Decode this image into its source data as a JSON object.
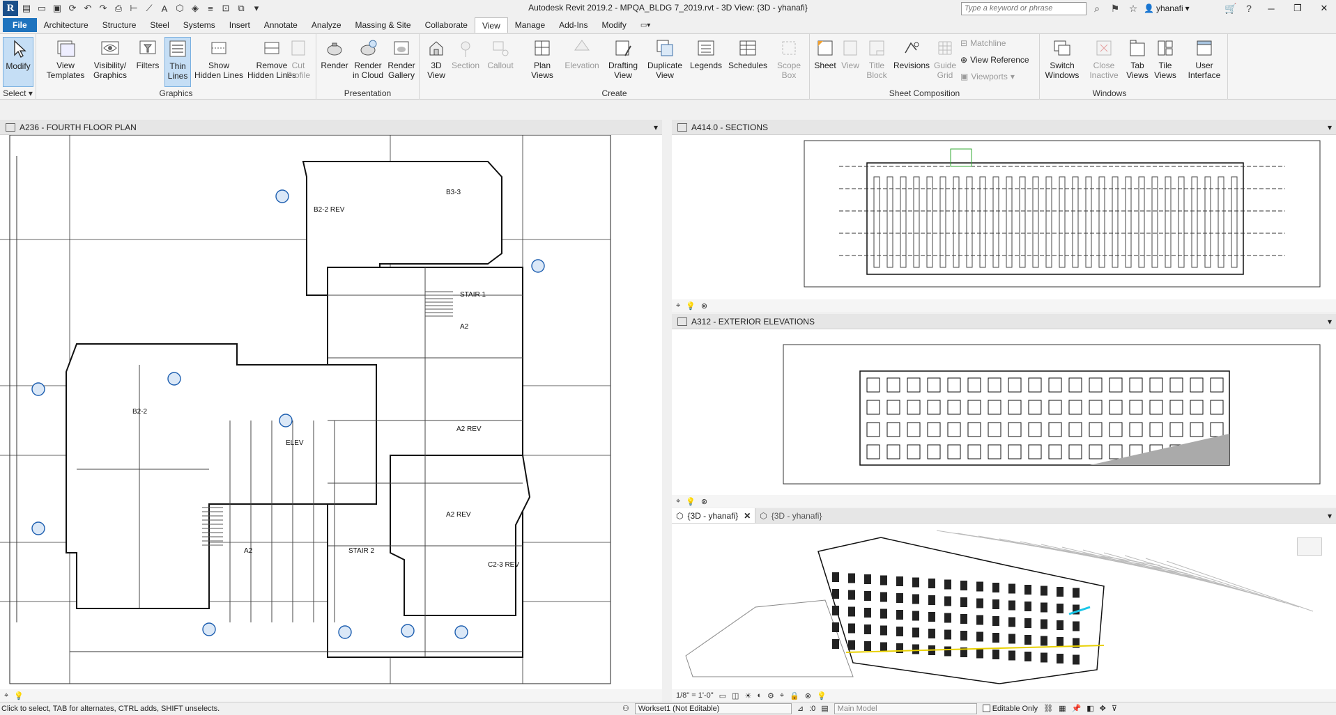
{
  "titlebar": {
    "title": "Autodesk Revit 2019.2 - MPQA_BLDG 7_2019.rvt - 3D View: {3D - yhanafi}",
    "search_placeholder": "Type a keyword or phrase",
    "username": "yhanafi"
  },
  "menu": {
    "file": "File",
    "items": [
      "Architecture",
      "Structure",
      "Steel",
      "Systems",
      "Insert",
      "Annotate",
      "Analyze",
      "Massing & Site",
      "Collaborate",
      "View",
      "Manage",
      "Add-Ins",
      "Modify"
    ],
    "active_index": 9
  },
  "ribbon": {
    "select": {
      "modify": "Modify",
      "label": "Select"
    },
    "graphics": {
      "label": "Graphics",
      "view_templates": "View\nTemplates",
      "visibility_graphics": "Visibility/\nGraphics",
      "filters": "Filters",
      "thin_lines": "Thin\nLines",
      "show_hidden": "Show\nHidden Lines",
      "remove_hidden": "Remove\nHidden Lines",
      "cut_profile": "Cut\nProfile"
    },
    "presentation": {
      "label": "Presentation",
      "render": "Render",
      "render_cloud": "Render\nin Cloud",
      "render_gallery": "Render\nGallery"
    },
    "create": {
      "label": "Create",
      "view_3d": "3D\nView",
      "section": "Section",
      "callout": "Callout",
      "plan_views": "Plan\nViews",
      "elevation": "Elevation",
      "drafting_view": "Drafting\nView",
      "duplicate_view": "Duplicate\nView",
      "legends": "Legends",
      "schedules": "Schedules",
      "scope_box": "Scope\nBox"
    },
    "sheet_composition": {
      "label": "Sheet Composition",
      "sheet": "Sheet",
      "view": "View",
      "title_block": "Title\nBlock",
      "revisions": "Revisions",
      "guide_grid": "Guide\nGrid",
      "matchline": "Matchline",
      "view_reference": "View  Reference",
      "viewports": "Viewports"
    },
    "windows": {
      "label": "Windows",
      "switch_windows": "Switch\nWindows",
      "close_inactive": "Close\nInactive",
      "tab_views": "Tab\nViews",
      "tile_views": "Tile\nViews"
    },
    "user_interface": "User\nInterface"
  },
  "views": {
    "floor_plan": {
      "title": "A236 - FOURTH FLOOR PLAN",
      "room_labels": [
        "B2-2 REV",
        "B3-3",
        "STAIR 1",
        "A2",
        "B2-2",
        "ELEV",
        "A2 REV",
        "A2 REV",
        "A2",
        "STAIR 2",
        "C2-3 REV"
      ]
    },
    "sections": {
      "title": "A414.0 - SECTIONS"
    },
    "elevations": {
      "title": "A312 - EXTERIOR ELEVATIONS"
    },
    "view3d": {
      "tab_active": "{3D - yhanafi}",
      "tab_other": "{3D - yhanafi}",
      "scale": "1/8\" = 1'-0\""
    }
  },
  "status": {
    "hint": "Click to select, TAB for alternates, CTRL adds, SHIFT unselects.",
    "workset": "Workset1 (Not Editable)",
    "counter": ":0",
    "design_option": "Main Model",
    "editable_only": "Editable Only"
  }
}
